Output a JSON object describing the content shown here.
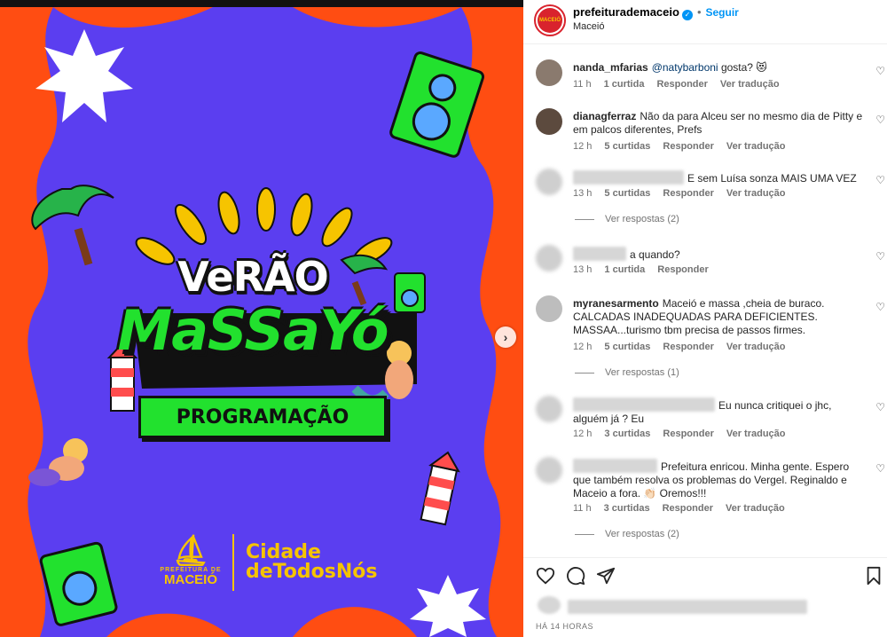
{
  "post": {
    "account": "prefeiturademaceio",
    "verified_icon": "verified-badge-icon",
    "follow_label": "Seguir",
    "location": "Maceió",
    "avatar_text": "MACEIÓ",
    "time_ago": "HÁ 14 HORAS"
  },
  "poster": {
    "title_line1": "VeRÃO",
    "title_line2": "MaSSaYó",
    "button_label": "PROGRAMAÇÃO",
    "logo_small": "PREFEITURA DE",
    "logo_big": "MACEIÓ",
    "slogan_line1": "Cidade",
    "slogan_line2": "deTodosNós",
    "colors": {
      "background": "#5b3ef0",
      "orange": "#ff4d12",
      "green": "#22e12e",
      "yellow": "#f6c400"
    }
  },
  "comments": [
    {
      "user": "nanda_mfarias",
      "mention": "@natybarboni",
      "text": " gosta? 😻",
      "time": "11 h",
      "likes": "1 curtida",
      "reply": "Responder",
      "translate": "Ver tradução",
      "replies": "",
      "blurred": false
    },
    {
      "user": "dianagferraz",
      "mention": "",
      "text": "Não da para Alceu ser no mesmo dia de Pitty e em palcos diferentes, Prefs",
      "time": "12 h",
      "likes": "5 curtidas",
      "reply": "Responder",
      "translate": "Ver tradução",
      "replies": "",
      "blurred": false
    },
    {
      "user": "",
      "mention": "",
      "text": "E sem Luísa sonza MAIS UMA VEZ",
      "time": "13 h",
      "likes": "5 curtidas",
      "reply": "Responder",
      "translate": "Ver tradução",
      "replies": "Ver respostas (2)",
      "blurred": true
    },
    {
      "user": "",
      "mention": "",
      "text": "a quando?",
      "time": "13 h",
      "likes": "1 curtida",
      "reply": "Responder",
      "translate": "",
      "replies": "",
      "blurred": true
    },
    {
      "user": "myranesarmento",
      "mention": "",
      "text": "Maceió e massa ,cheia de buraco. CALCADAS INADEQUADAS PARA DEFICIENTES. MASSAA...turismo tbm precisa de passos firmes.",
      "time": "12 h",
      "likes": "5 curtidas",
      "reply": "Responder",
      "translate": "Ver tradução",
      "replies": "Ver respostas (1)",
      "blurred": false
    },
    {
      "user": "",
      "mention": "",
      "text": "Eu nunca critiquei o jhc, alguém já ? Eu",
      "time": "12 h",
      "likes": "3 curtidas",
      "reply": "Responder",
      "translate": "Ver tradução",
      "replies": "",
      "blurred": true
    },
    {
      "user": "",
      "mention": "",
      "text": "Prefeitura enricou. Minha gente. Espero que também resolva os problemas do Vergel. Reginaldo e Maceio a fora. 👏🏻 Oremos!!!",
      "time": "11 h",
      "likes": "3 curtidas",
      "reply": "Responder",
      "translate": "Ver tradução",
      "replies": "Ver respostas (2)",
      "blurred": true
    }
  ],
  "icons": {
    "like": "heart-icon",
    "comment": "comment-icon",
    "share": "share-icon",
    "save": "bookmark-icon",
    "next": "chevron-right-icon"
  }
}
